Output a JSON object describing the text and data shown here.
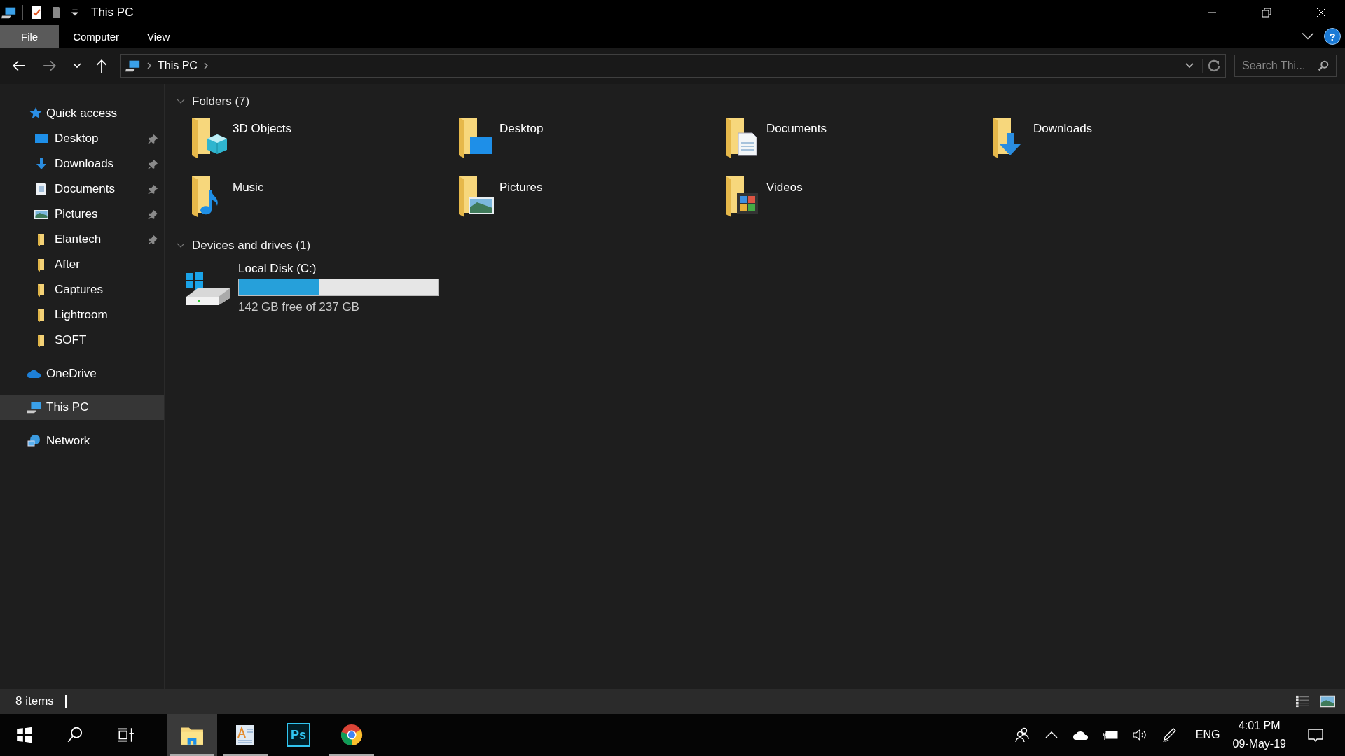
{
  "window": {
    "title": "This PC"
  },
  "ribbon_tabs": [
    {
      "label": "File",
      "selected": true
    },
    {
      "label": "Computer",
      "selected": false
    },
    {
      "label": "View",
      "selected": false
    }
  ],
  "help": "?",
  "address": {
    "segments": [
      "This PC"
    ]
  },
  "search": {
    "placeholder": "Search Thi..."
  },
  "sidebar": {
    "items": [
      {
        "kind": "quick",
        "label": "Quick access",
        "selected": false,
        "children": [
          {
            "kind": "desktop",
            "label": "Desktop",
            "pinned": true
          },
          {
            "kind": "downloads",
            "label": "Downloads",
            "pinned": true
          },
          {
            "kind": "documents",
            "label": "Documents",
            "pinned": true
          },
          {
            "kind": "pictures",
            "label": "Pictures",
            "pinned": true
          },
          {
            "kind": "folder",
            "label": "Elantech",
            "pinned": true
          },
          {
            "kind": "folder",
            "label": "After",
            "pinned": false
          },
          {
            "kind": "folder",
            "label": "Captures",
            "pinned": false
          },
          {
            "kind": "folder",
            "label": "Lightroom",
            "pinned": false
          },
          {
            "kind": "folder",
            "label": "SOFT",
            "pinned": false
          }
        ]
      },
      {
        "kind": "onedrive",
        "label": "OneDrive",
        "selected": false
      },
      {
        "kind": "pc",
        "label": "This PC",
        "selected": true
      },
      {
        "kind": "network",
        "label": "Network",
        "selected": false
      }
    ]
  },
  "sections": [
    {
      "title": "Folders (7)",
      "expanded": true,
      "kind": "folders",
      "items": [
        {
          "kind": "objects",
          "label": "3D Objects"
        },
        {
          "kind": "desktop",
          "label": "Desktop"
        },
        {
          "kind": "documents",
          "label": "Documents"
        },
        {
          "kind": "downloads",
          "label": "Downloads"
        },
        {
          "kind": "music",
          "label": "Music"
        },
        {
          "kind": "pictures",
          "label": "Pictures"
        },
        {
          "kind": "videos",
          "label": "Videos"
        }
      ]
    },
    {
      "title": "Devices and drives (1)",
      "expanded": true,
      "kind": "drives",
      "items": [
        {
          "kind": "disk",
          "label": "Local Disk (C:)",
          "level": 0.4,
          "detail": "142 GB free of 237 GB"
        }
      ]
    }
  ],
  "status_bar": {
    "count": "8 items"
  },
  "taskbar": {
    "apps": [
      {
        "kind": "explorer",
        "running": true,
        "selected": true
      },
      {
        "kind": "wordpad",
        "running": true,
        "selected": false
      },
      {
        "kind": "photoshop",
        "text": "Ps",
        "running": false,
        "selected": false
      },
      {
        "kind": "chrome",
        "running": true,
        "selected": false
      }
    ],
    "language": "ENG",
    "time": "4:01 PM",
    "date": "09-May-19"
  }
}
